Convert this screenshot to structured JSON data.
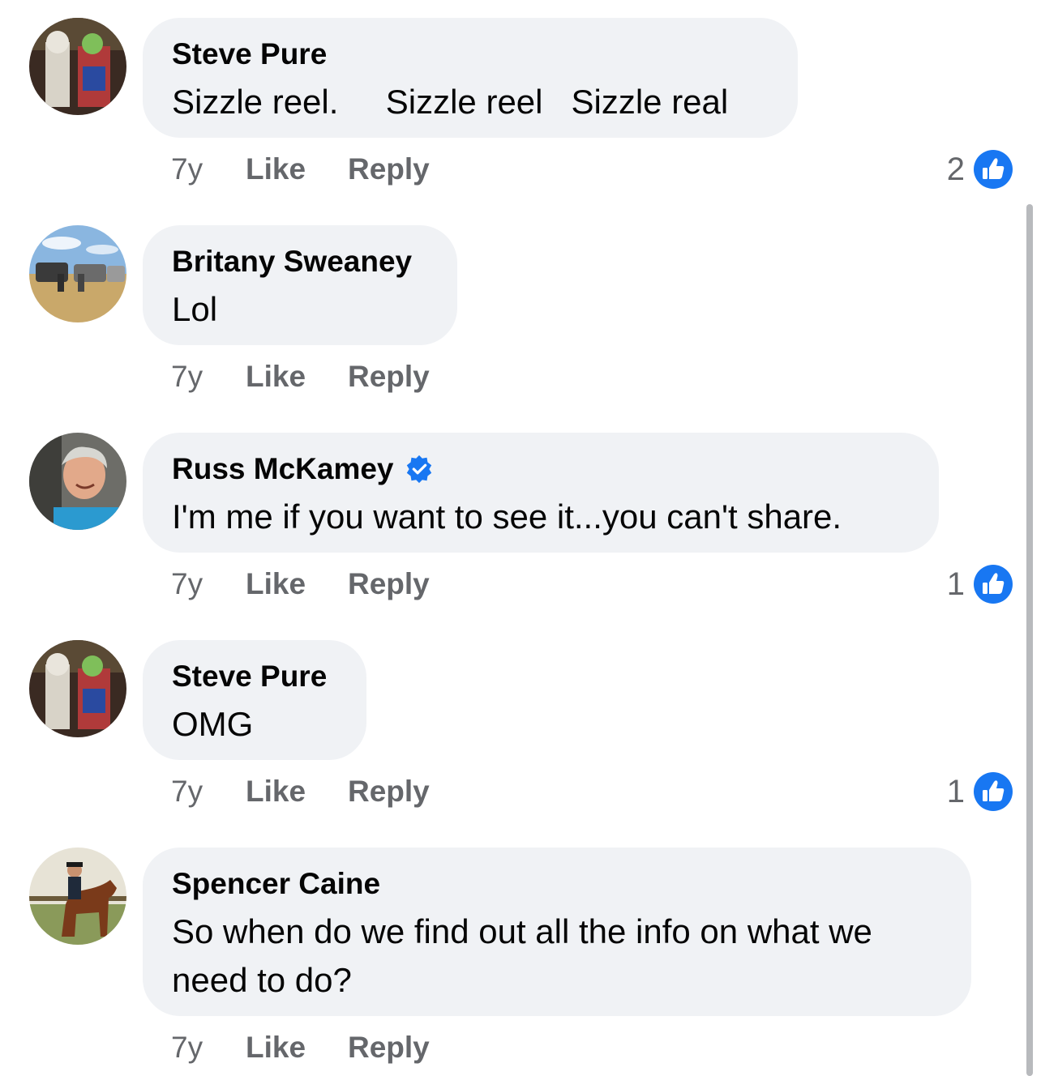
{
  "comments": [
    {
      "author": "Steve Pure",
      "text": "Sizzle reel.     Sizzle reel   Sizzle real",
      "time": "7y",
      "like": "Like",
      "reply": "Reply",
      "reactions": "2",
      "verified": false
    },
    {
      "author": "Britany Sweaney",
      "text": "Lol",
      "time": "7y",
      "like": "Like",
      "reply": "Reply",
      "reactions": "",
      "verified": false
    },
    {
      "author": "Russ McKamey",
      "text": "I'm me if you want to see it...you can't share.",
      "time": "7y",
      "like": "Like",
      "reply": "Reply",
      "reactions": "1",
      "verified": true
    },
    {
      "author": "Steve Pure",
      "text": "OMG",
      "time": "7y",
      "like": "Like",
      "reply": "Reply",
      "reactions": "1",
      "verified": false
    },
    {
      "author": "Spencer Caine",
      "text": "So when do we find out all the info on what we need to do?",
      "time": "7y",
      "like": "Like",
      "reply": "Reply",
      "reactions": "",
      "verified": false
    }
  ],
  "icons": {
    "reaction": "like-thumb-icon",
    "verified": "verified-badge-icon"
  },
  "colors": {
    "accent": "#1877f2",
    "bubble": "#f0f2f5",
    "meta": "#65676b"
  }
}
